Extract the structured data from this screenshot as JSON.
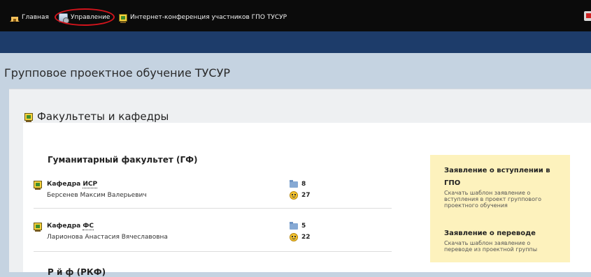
{
  "nav": {
    "home": "Главная",
    "manage": "Управление",
    "conference": "Интернет-конференция участников ГПО ТУСУР"
  },
  "page": {
    "title": "Групповое проектное обучение ТУСУР"
  },
  "section": {
    "title": "Факультеты и кафедры"
  },
  "faculty": {
    "title": "Гуманитарный факультет (ГФ)",
    "departments": [
      {
        "prefix": "Кафедра ",
        "code": "ИСР",
        "head": "Берсенев Максим Валерьевич",
        "projects": "8",
        "students": "27"
      },
      {
        "prefix": "Кафедра ",
        "code": "ФС",
        "head": "Ларионова Анастасия Вячеславовна",
        "projects": "5",
        "students": "22"
      }
    ]
  },
  "next_faculty": {
    "title": "Р                              й ф           (РКФ)"
  },
  "sidebar": {
    "apply": {
      "title": "Заявление о вступлении в ГПО",
      "desc": "Скачать шаблон заявление о вступления в проект группового проектного обучения"
    },
    "transfer": {
      "title": "Заявление о переводе",
      "desc": "Скачать шаблон заявление о переводе из проектной группы"
    }
  },
  "colors": {
    "topbar": "#0b0b0b",
    "band": "#1d3c6a",
    "background": "#c5d3e1",
    "sidebox": "#fdf2bd",
    "annotation": "#d3141c"
  },
  "icons": [
    "home-icon",
    "manage-icon",
    "board-icon",
    "folder-icon",
    "smiley-icon"
  ]
}
